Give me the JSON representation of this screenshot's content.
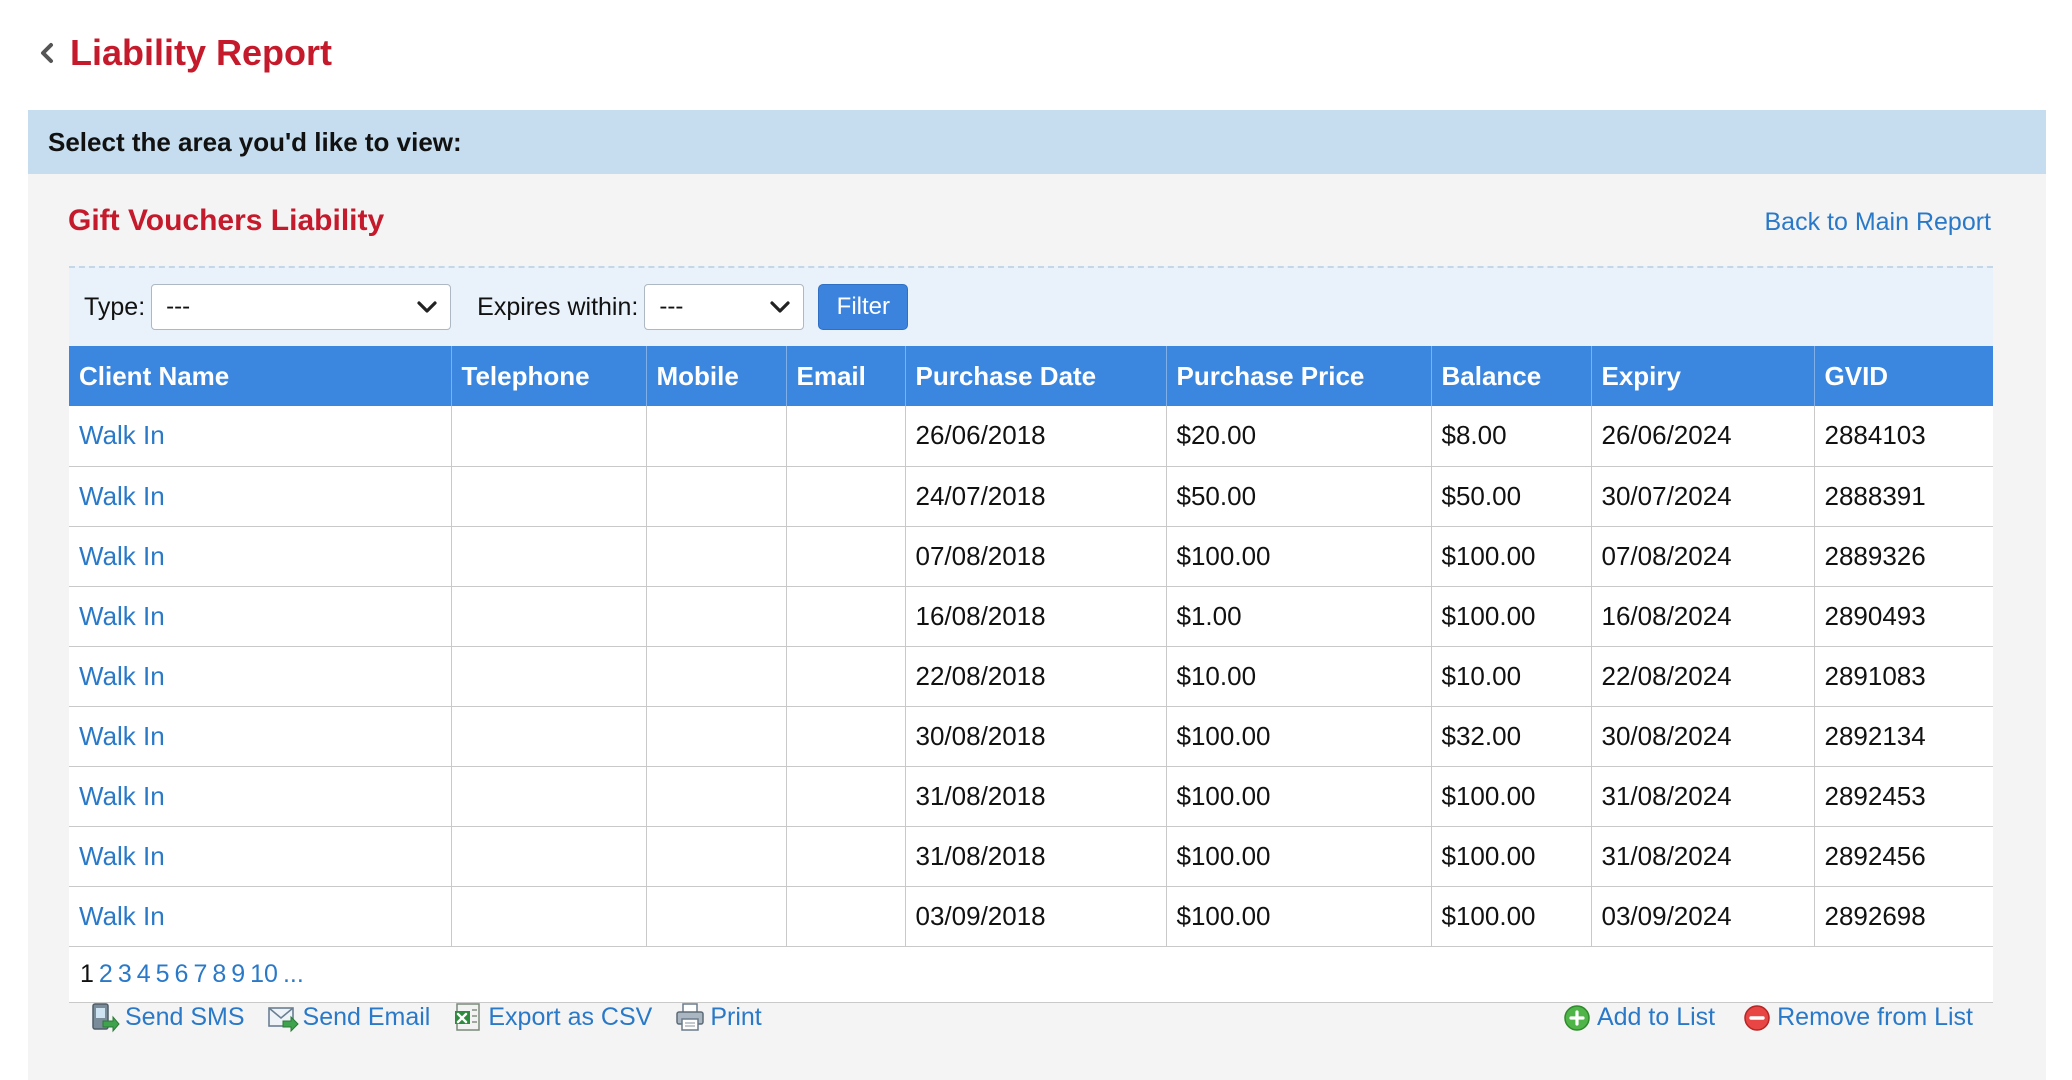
{
  "header": {
    "title": "Liability Report"
  },
  "area_bar": {
    "text": "Select the area you'd like to view:"
  },
  "panel": {
    "title": "Gift Vouchers Liability",
    "back_link": "Back to Main Report"
  },
  "filters": {
    "type_label": "Type:",
    "type_value": "---",
    "expires_label": "Expires within:",
    "expires_value": "---",
    "filter_button": "Filter"
  },
  "table": {
    "columns": [
      "Client Name",
      "Telephone",
      "Mobile",
      "Email",
      "Purchase Date",
      "Purchase Price",
      "Balance",
      "Expiry",
      "GVID"
    ],
    "rows": [
      [
        "Walk In",
        "",
        "",
        "",
        "26/06/2018",
        "$20.00",
        "$8.00",
        "26/06/2024",
        "2884103"
      ],
      [
        "Walk In",
        "",
        "",
        "",
        "24/07/2018",
        "$50.00",
        "$50.00",
        "30/07/2024",
        "2888391"
      ],
      [
        "Walk In",
        "",
        "",
        "",
        "07/08/2018",
        "$100.00",
        "$100.00",
        "07/08/2024",
        "2889326"
      ],
      [
        "Walk In",
        "",
        "",
        "",
        "16/08/2018",
        "$1.00",
        "$100.00",
        "16/08/2024",
        "2890493"
      ],
      [
        "Walk In",
        "",
        "",
        "",
        "22/08/2018",
        "$10.00",
        "$10.00",
        "22/08/2024",
        "2891083"
      ],
      [
        "Walk In",
        "",
        "",
        "",
        "30/08/2018",
        "$100.00",
        "$32.00",
        "30/08/2024",
        "2892134"
      ],
      [
        "Walk In",
        "",
        "",
        "",
        "31/08/2018",
        "$100.00",
        "$100.00",
        "31/08/2024",
        "2892453"
      ],
      [
        "Walk In",
        "",
        "",
        "",
        "31/08/2018",
        "$100.00",
        "$100.00",
        "31/08/2024",
        "2892456"
      ],
      [
        "Walk In",
        "",
        "",
        "",
        "03/09/2018",
        "$100.00",
        "$100.00",
        "03/09/2024",
        "2892698"
      ]
    ]
  },
  "pagination": {
    "current": "1",
    "pages": [
      "2",
      "3",
      "4",
      "5",
      "6",
      "7",
      "8",
      "9",
      "10",
      "..."
    ]
  },
  "actions": {
    "send_sms": "Send SMS",
    "send_email": "Send Email",
    "export_csv": "Export as CSV",
    "print": "Print",
    "add_to_list": "Add to List",
    "remove_from_list": "Remove from List"
  },
  "colors": {
    "title_red": "#c41a2b",
    "link_blue": "#2a79c8",
    "header_blue": "#3b87e0",
    "area_bar_bg": "#c5ddee",
    "panel_bg": "#f4f4f4",
    "filter_bg": "#e9f1fa"
  }
}
